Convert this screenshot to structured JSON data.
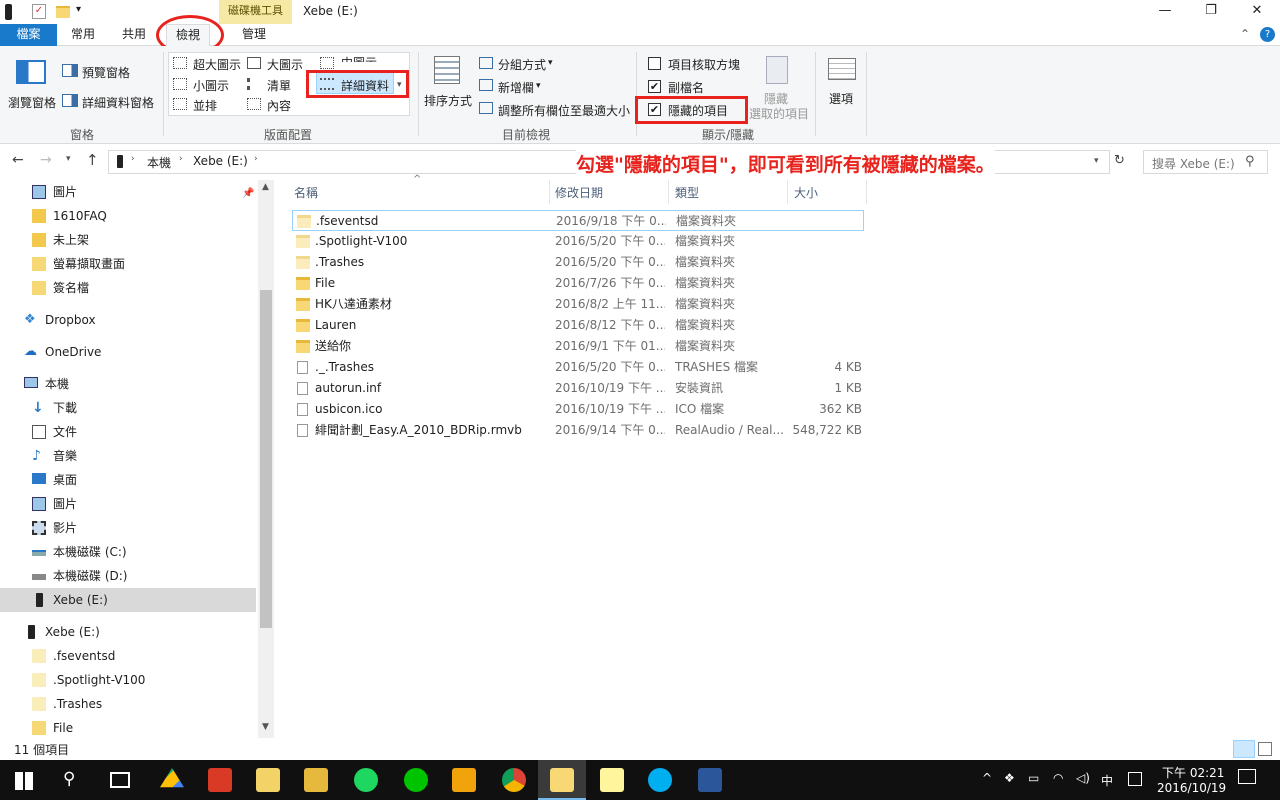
{
  "window": {
    "title": "Xebe (E:)",
    "context_tab": "磁碟機工具",
    "controls": {
      "minimize": "—",
      "restore": "❐",
      "close": "✕"
    }
  },
  "tabs": [
    "檔案",
    "常用",
    "共用",
    "檢視",
    "管理"
  ],
  "ribbon": {
    "panes": {
      "nav_pane": "瀏覽窗格",
      "preview_pane": "預覽窗格",
      "details_pane": "詳細資料窗格",
      "label": "窗格"
    },
    "layout": {
      "items": [
        "超大圖示",
        "大圖示",
        "中圖示",
        "小圖示",
        "清單",
        "詳細資料",
        "並排",
        "內容"
      ],
      "label": "版面配置"
    },
    "current_view": {
      "sort_by": "排序方式",
      "group_by": "分組方式",
      "add_columns": "新增欄",
      "size_all_columns": "調整所有欄位至最適大小",
      "label": "目前檢視"
    },
    "show_hide": {
      "item_check_boxes": "項目核取方塊",
      "file_name_extensions": "副檔名",
      "hidden_items": "隱藏的項目",
      "hide_selected_line1": "隱藏",
      "hide_selected_line2": "選取的項目",
      "label": "顯示/隱藏"
    },
    "options": "選項"
  },
  "address": {
    "path": [
      "本機",
      "Xebe (E:)"
    ],
    "search_placeholder": "搜尋 Xebe (E:)",
    "annotation": "勾選\"隱藏的項目\"，即可看到所有被隱藏的檔案。"
  },
  "nav": {
    "quick_access": [
      "圖片",
      "1610FAQ",
      "未上架",
      "螢幕擷取畫面",
      "簽名檔"
    ],
    "dropbox": "Dropbox",
    "onedrive": "OneDrive",
    "this_pc": "本機",
    "pc_items": [
      "下載",
      "文件",
      "音樂",
      "桌面",
      "圖片",
      "影片",
      "本機磁碟 (C:)",
      "本機磁碟 (D:)",
      "Xebe (E:)"
    ],
    "drive": "Xebe (E:)",
    "drive_items": [
      ".fseventsd",
      ".Spotlight-V100",
      ".Trashes",
      "File"
    ]
  },
  "columns": {
    "name": "名稱",
    "date": "修改日期",
    "type": "類型",
    "size": "大小"
  },
  "files": [
    {
      "name": ".fseventsd",
      "date": "2016/9/18 下午 0...",
      "type": "檔案資料夾",
      "size": ""
    },
    {
      "name": ".Spotlight-V100",
      "date": "2016/5/20 下午 0...",
      "type": "檔案資料夾",
      "size": ""
    },
    {
      "name": ".Trashes",
      "date": "2016/5/20 下午 0...",
      "type": "檔案資料夾",
      "size": ""
    },
    {
      "name": "File",
      "date": "2016/7/26 下午 0...",
      "type": "檔案資料夾",
      "size": ""
    },
    {
      "name": "HK八達通素材",
      "date": "2016/8/2 上午 11...",
      "type": "檔案資料夾",
      "size": ""
    },
    {
      "name": "Lauren",
      "date": "2016/8/12 下午 0...",
      "type": "檔案資料夾",
      "size": ""
    },
    {
      "name": "送給你",
      "date": "2016/9/1 下午 01...",
      "type": "檔案資料夾",
      "size": ""
    },
    {
      "name": "._.Trashes",
      "date": "2016/5/20 下午 0...",
      "type": "TRASHES 檔案",
      "size": "4 KB"
    },
    {
      "name": "autorun.inf",
      "date": "2016/10/19 下午 ...",
      "type": "安裝資訊",
      "size": "1 KB"
    },
    {
      "name": "usbicon.ico",
      "date": "2016/10/19 下午 ...",
      "type": "ICO 檔案",
      "size": "362 KB"
    },
    {
      "name": "緋聞計劃_Easy.A_2010_BDRip.rmvb",
      "date": "2016/9/14 下午 0...",
      "type": "RealAudio / Real...",
      "size": "548,722 KB"
    }
  ],
  "status": {
    "count": "11 個項目"
  },
  "taskbar": {
    "time": "下午 02:21",
    "date": "2016/10/19",
    "ime": "中"
  },
  "colors": {
    "accent": "#1979ca",
    "annotation": "#e8231d",
    "context_tab": "#f6e9a6"
  }
}
